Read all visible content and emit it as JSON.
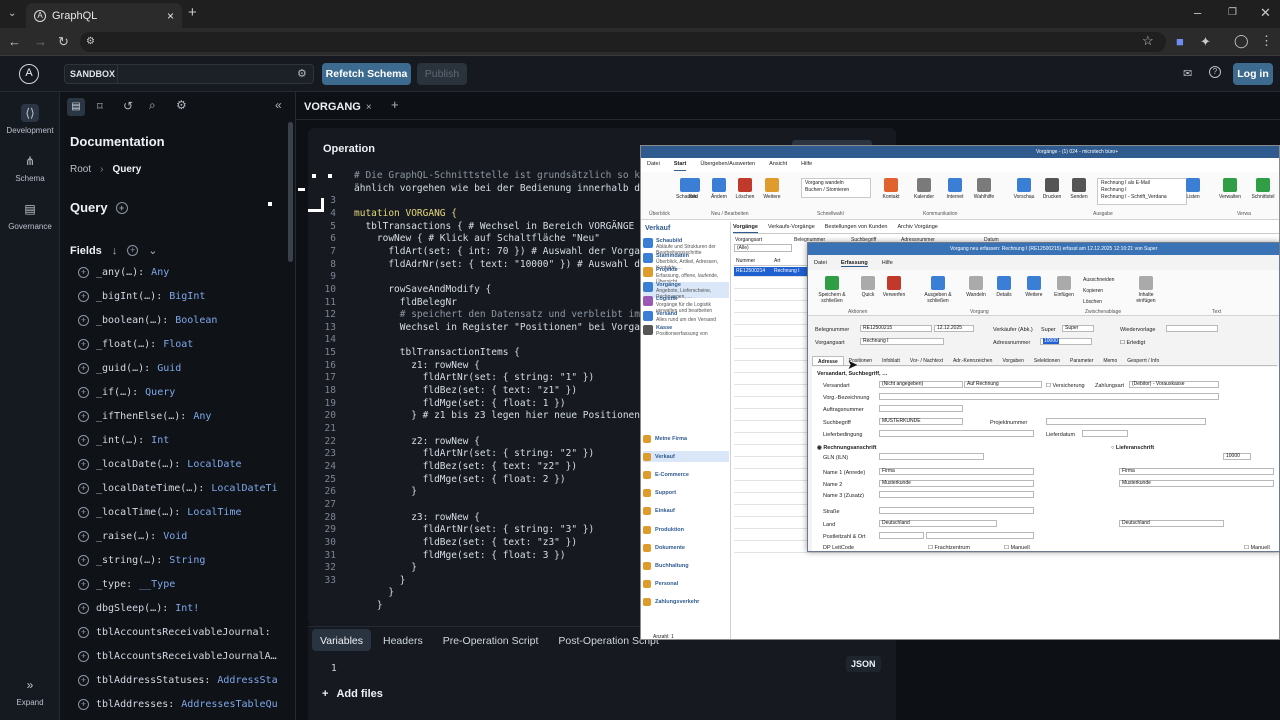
{
  "browser": {
    "tab_title": "GraphQL"
  },
  "header": {
    "sandbox": "SANDBOX",
    "refetch": "Refetch Schema",
    "publish": "Publish",
    "login": "Log in"
  },
  "rail": {
    "development": "Development",
    "schema": "Schema",
    "governance": "Governance",
    "expand": "Expand"
  },
  "docs": {
    "title": "Documentation",
    "crumb_root": "Root",
    "crumb_sep": "›",
    "crumb_current": "Query",
    "section": "Query",
    "fields_label": "Fields",
    "fields": [
      {
        "name": "_any(…):",
        "type": "Any"
      },
      {
        "name": "_bigInt(…):",
        "type": "BigInt"
      },
      {
        "name": "_boolean(…):",
        "type": "Boolean"
      },
      {
        "name": "_float(…):",
        "type": "Float"
      },
      {
        "name": "_guid(…):",
        "type": "Guid"
      },
      {
        "name": "_if(…):",
        "type": "Query"
      },
      {
        "name": "_ifThenElse(…):",
        "type": "Any"
      },
      {
        "name": "_int(…):",
        "type": "Int"
      },
      {
        "name": "_localDate(…):",
        "type": "LocalDate"
      },
      {
        "name": "_localDateTime(…):",
        "type": "LocalDateTi…"
      },
      {
        "name": "_localTime(…):",
        "type": "LocalTime"
      },
      {
        "name": "_raise(…):",
        "type": "Void"
      },
      {
        "name": "_string(…):",
        "type": "String"
      },
      {
        "name": "_type:",
        "type": "__Type"
      },
      {
        "name": "dbgSleep(…):",
        "type": "Int!"
      },
      {
        "name": "tblAccountsReceivableJournal:",
        "type": "A…"
      },
      {
        "name": "tblAccountsReceivableJournalA…",
        "type": ""
      },
      {
        "name": "tblAddressStatuses:",
        "type": "AddressSta…"
      },
      {
        "name": "tblAddresses:",
        "type": "AddressesTableQu…"
      }
    ]
  },
  "editor": {
    "tab": "VORGANG",
    "operation": "Operation",
    "line_numbers": [
      "",
      "",
      "3",
      "4",
      "5",
      "6",
      "7",
      "8",
      "9",
      "10",
      "11",
      "12",
      "13",
      "14",
      "15",
      "16",
      "17",
      "18",
      "19",
      "20",
      "21",
      "22",
      "23",
      "24",
      "25",
      "26",
      "27",
      "28",
      "29",
      "30",
      "31",
      "32",
      "33"
    ],
    "lines": [
      "# Die GraphQL-Schnittstelle ist grundsätzlich so ko",
      "ähnlich vorgehen wie bei der Bedienung innerhalb de",
      "",
      "mutation VORGANG {",
      "  tblTransactions { # Wechsel in Bereich VORGÄNGE",
      "    rowNew { # Klick auf Schaltfläche \"Neu\"",
      "      fldArt(set: { int: 70 }) # Auswahl der Vorgan",
      "      fldAdrNr(set: { text: \"10000\" }) # Auswahl de",
      "",
      "      rowSaveAndModify {",
      "        fldBelegNr",
      "        # speichert den Datensatz und verbleibt im",
      "        Wechsel in Register \"Positionen\" bei Vorgan",
      "",
      "        tblTransactionItems {",
      "          z1: rowNew {",
      "            fldArtNr(set: { string: \"1\" })",
      "            fldBez(set: { text: \"z1\" })",
      "            fldMge(set: { float: 1 })",
      "          } # z1 bis z3 legen hier neue Positionen",
      "",
      "          z2: rowNew {",
      "            fldArtNr(set: { string: \"2\" })",
      "            fldBez(set: { text: \"z2\" })",
      "            fldMge(set: { float: 2 })",
      "          }",
      "",
      "          z3: rowNew {",
      "            fldArtNr(set: { string: \"3\" })",
      "            fldBez(set: { text: \"z3\" })",
      "            fldMge(set: { float: 3 })",
      "          }",
      "        }",
      "      }",
      "    }"
    ]
  },
  "variables": {
    "tabs": [
      "Variables",
      "Headers",
      "Pre-Operation Script",
      "Post-Operation Script"
    ],
    "line1": "1",
    "json": "JSON",
    "add_files": "Add files"
  },
  "desktop": {
    "title": "Vorgänge - (1) 024 - microtech büro+",
    "menu": [
      "Datei",
      "Start",
      "Übergeben/Auswerten",
      "Ansicht",
      "Hilfe"
    ],
    "ribbon": [
      "Schaubild",
      "Neu",
      "Ändern",
      "Löschen",
      "Weitere",
      "Kontakt",
      "Kalender",
      "Internet",
      "Wahlhilfe",
      "Vorschau",
      "Drucken",
      "Senden",
      "Listen",
      "Verwalten",
      "Schnittstel"
    ],
    "ribbon_list1": [
      "Vorgang wandeln",
      "Buchen / Stornieren"
    ],
    "ribbon_list2": [
      "Rechnung I als E-Mail",
      "Rechnung I",
      "Rechnung I - Schrift_Verdana"
    ],
    "groups": [
      "Überblick",
      "Neu / Bearbeiten",
      "Schnellwahl",
      "Kommunikation",
      "Ausgabe",
      "Verwa"
    ],
    "nav_title": "Verkauf",
    "nav": [
      {
        "t": "Schaubild",
        "s": "Abläufe und Strukturen der Bearbeitungsschritte"
      },
      {
        "t": "Stammdaten",
        "s": "Überblick, Artikel, Adressen, Kontakte,…"
      },
      {
        "t": "Projekte",
        "s": "Erfassung, offene, laufende, Übersicht, …"
      },
      {
        "t": "Vorgänge",
        "s": "Angebote, Lieferscheine, Rechnungen, …"
      },
      {
        "t": "Logistik",
        "s": "Vorgänge für die Logistik verwalten und bearbeiten"
      },
      {
        "t": "Versand",
        "s": "Alles rund um den Versand"
      },
      {
        "t": "Kasse",
        "s": "Positionserfassung von"
      }
    ],
    "nav_groups": [
      "Meine Firma",
      "Verkauf",
      "E-Commerce",
      "Support",
      "Einkauf",
      "Produktion",
      "Dokumente",
      "Buchhaltung",
      "Personal",
      "Zahlungsverkehr"
    ],
    "tabs": [
      "Vorgänge",
      "Verkaufs-Vorgänge",
      "Bestellungen von Kunden",
      "Archiv Vorgänge"
    ],
    "filter_label": "Vorgangsart",
    "filter_value": "(Alle)",
    "cols": [
      "Belegnummer",
      "Suchbegriff",
      "Adressnummer",
      "Datum"
    ],
    "listcols": [
      "Nummer",
      "Art"
    ],
    "row": {
      "nr": "RE12500214",
      "art": "Rechnung I"
    },
    "status": "Anzahl: 1"
  },
  "dialog": {
    "title": "Vorgang neu erfassen: Rechnung I (RE12500215) erfasst am 12.12.2025 12:10:21 von Super",
    "menu": [
      "Datei",
      "Erfassung",
      "Hilfe"
    ],
    "buttons": [
      "Speichern & schließen",
      "Quick",
      "Verwerfen",
      "Ausgeben & schließen",
      "Wandeln",
      "Details",
      "Weitere",
      "Einfügen",
      "Inhalte einfügen"
    ],
    "clip": [
      "Ausschneiden",
      "Kopieren",
      "Löschen"
    ],
    "groups": [
      "Aktionen",
      "Vorgang",
      "Zwischenablage",
      "Text"
    ],
    "belegnr_label": "Belegnummer",
    "belegnr": "RE12500215",
    "datum": "12.12.2025",
    "verk_label": "Verkäufer (Abk.)",
    "verk": "Super",
    "verk2": "Super",
    "wv_label": "Wiedervorlage",
    "vart_label": "Vorgangsart",
    "vart": "Rechnung I",
    "adr_label": "Adressnummer",
    "adr": "10000",
    "erledigt": "Erledigt",
    "tabs": [
      "Adresse",
      "Positionen",
      "Infoblatt",
      "Vor- / Nachtext",
      "Adr.-Kennzeichen",
      "Vorgaben",
      "Selektionen",
      "Parameter",
      "Memo",
      "Gesperrt / Info"
    ],
    "section": "Versandart, Suchbegriff, …",
    "versandart_label": "Versandart",
    "versandart": "(Nicht angegeben)",
    "auf_rechnung": "Auf Rechnung",
    "versicherung": "Versicherung",
    "zahlungsart_label": "Zahlungsart",
    "zahlungsart": "(Debitor) - Vorauskasse",
    "vbez": "Vorg.-Bezeichnung",
    "auftrag": "Auftragsnummer",
    "such_label": "Suchbegriff",
    "such": "MUSTERKUNDE",
    "projekt": "Projektnummer",
    "lief_label": "Lieferbedingung",
    "liefdat": "Lieferdatum",
    "rechnung": "Rechnungsanschrift",
    "lieferung": "Lieferanschrift",
    "gln": "GLN (ILN)",
    "adr_right": "10000",
    "name1_label": "Name 1 (Anrede)",
    "name1": "Firma",
    "name1r": "Firma",
    "name2_label": "Name 2",
    "name2": "Musterkunde",
    "name2r": "Musterkunde",
    "name3_label": "Name 3 (Zusatz)",
    "strasse": "Straße",
    "land_label": "Land",
    "land": "Deutschland",
    "landr": "Deutschland",
    "plz": "Postleitzahl & Ort",
    "dp": "DP LeitCode",
    "fracht": "Frachtzentrum",
    "manuell": "Manuell",
    "manuell2": "Manuell"
  }
}
